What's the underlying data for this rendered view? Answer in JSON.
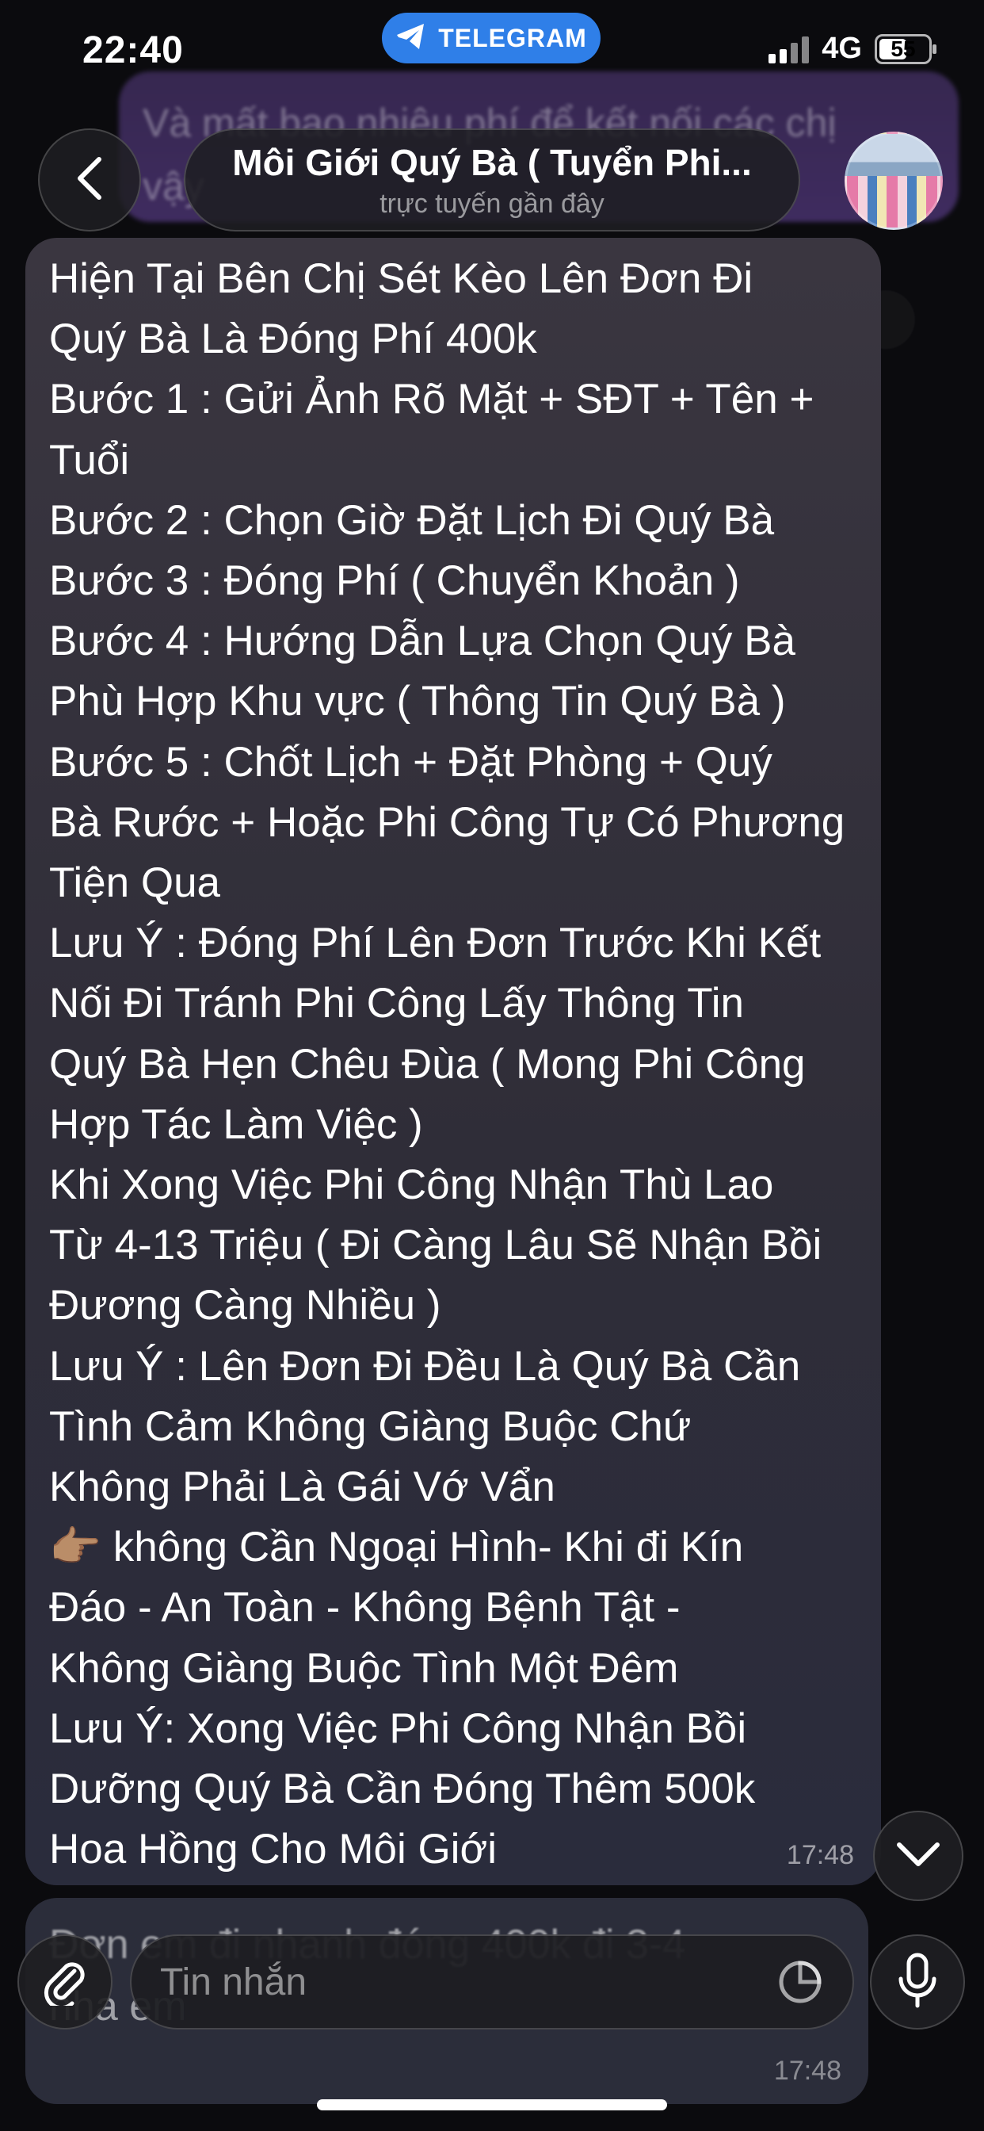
{
  "status_bar": {
    "time": "22:40",
    "app_badge": "TELEGRAM",
    "network": "4G",
    "battery": "55"
  },
  "background_message": {
    "line1": "Và mất bao nhiêu phí để kết nối các chị",
    "line2": "vậy"
  },
  "header": {
    "title": "Môi Giới Quý Bà ( Tuyển Phi...",
    "status": "trực tuyến gần đây"
  },
  "message": {
    "lines": [
      "Hiện Tại Bên Chị Sét Kèo Lên Đơn Đi",
      "Quý Bà Là Đóng Phí 400k",
      "Bước 1 : Gửi Ảnh Rõ Mặt + SĐT + Tên +",
      "Tuổi",
      "Bước 2 : Chọn Giờ Đặt Lịch Đi Quý Bà",
      "Bước 3 : Đóng Phí ( Chuyển Khoản )",
      "Bước 4 : Hướng Dẫn  Lựa Chọn Quý Bà",
      "Phù Hợp Khu vực ( Thông Tin Quý Bà )",
      "Bước 5 : Chốt Lịch + Đặt Phòng + Quý",
      "Bà Rước + Hoặc Phi Công Tự Có Phương",
      "Tiện Qua",
      "Lưu Ý : Đóng Phí Lên Đơn Trước Khi Kết",
      "Nối Đi Tránh Phi Công Lấy Thông Tin",
      "Quý Bà Hẹn Chêu Đùa ( Mong Phi Công",
      "Hợp Tác Làm Việc )",
      "Khi Xong Việc Phi Công Nhận Thù Lao",
      "Từ 4-13 Triệu ( Đi Càng Lâu Sẽ Nhận Bồi",
      "Đương Càng Nhiều )",
      "Lưu Ý : Lên Đơn Đi Đều Là Quý Bà Cần",
      "Tình Cảm Không Giàng Buộc Chứ",
      "Không Phải Là Gái Vớ Vẩn",
      "👉🏽 không Cần Ngoại Hình- Khi đi Kín",
      "Đáo - An Toàn - Không Bệnh Tật -",
      "Không Giàng Buộc Tình Một Đêm",
      "Lưu Ý: Xong Việc Phi Công Nhận Bồi",
      "Dưỡng Quý Bà Cần Đóng Thêm 500k",
      "Hoa Hồng Cho Môi Giới"
    ],
    "time": "17:48"
  },
  "message2": {
    "line1": "Đơn em đi nhanh đóng 400k đi 3-4",
    "line2": "nha em",
    "time": "17:48"
  },
  "composer": {
    "placeholder": "Tin nhắn"
  },
  "colors": {
    "telegram_blue": "#2f7fe8",
    "bubble": "#35333e",
    "background": "#0b0b0e"
  },
  "icons": [
    "back-chevron-icon",
    "telegram-plane-icon",
    "chevron-down-icon",
    "paperclip-icon",
    "sticker-icon",
    "microphone-icon"
  ]
}
